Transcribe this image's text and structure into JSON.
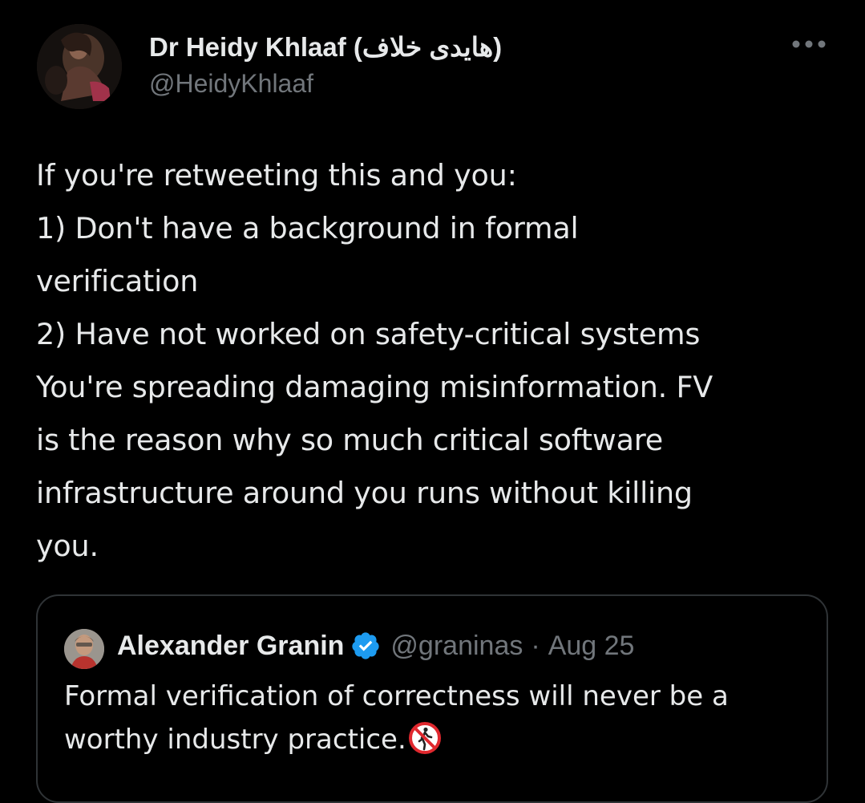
{
  "author": {
    "display_name": "Dr Heidy Khlaaf (هايدى خلاف)",
    "handle": "@HeidyKhlaaf"
  },
  "more_icon": "more-horizontal-icon",
  "tweet_lines": [
    "If you're retweeting this and you:",
    "1) Don't have a background in formal",
    "verification",
    "2) Have not worked on safety-critical systems",
    "You're spreading damaging misinformation. FV",
    "is the reason why so much critical software",
    "infrastructure around you runs without killing",
    "you."
  ],
  "quote": {
    "name": "Alexander Granin",
    "verified_icon": "verified-badge-icon",
    "handle": "@graninas",
    "separator": "·",
    "date": "Aug 25",
    "text_lines": [
      "Formal verification of correctness will never be a",
      "worthy industry practice."
    ],
    "emoji": "no-pedestrians-emoji"
  },
  "colors": {
    "background": "#000000",
    "primary_text": "#e7e9ea",
    "secondary_text": "#71767b",
    "border": "#2f3336",
    "verified_blue": "#1d9bf0",
    "emoji_red": "#e0282e"
  }
}
